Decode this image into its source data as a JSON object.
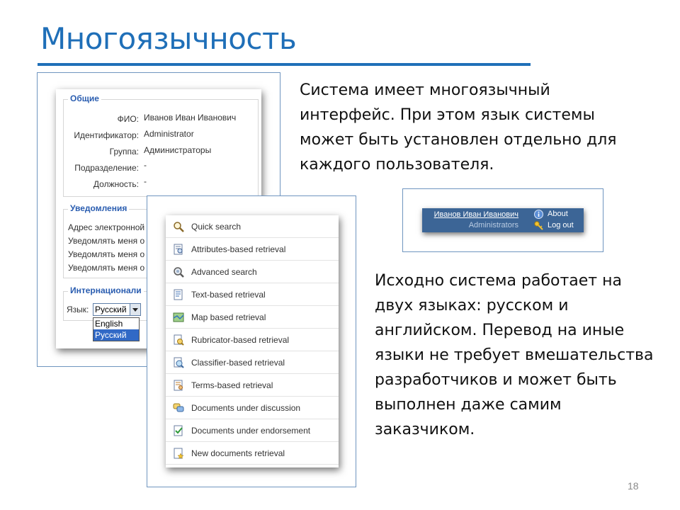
{
  "slide": {
    "title": "Многоязычность",
    "page_number": "18",
    "paragraph1": "Система имеет многоязычный интерфейс. При этом язык системы может быть установлен отдельно для каждого пользователя.",
    "paragraph2": "Исходно система работает на двух языках: русском и английском. Перевод на иные языки не требует вмешательства разработчиков и может быть выполнен даже самим заказчиком."
  },
  "profile_form": {
    "general": {
      "legend": "Общие",
      "fields": [
        {
          "label": "ФИО:",
          "value": "Иванов Иван Иванович"
        },
        {
          "label": "Идентификатор:",
          "value": "Administrator"
        },
        {
          "label": "Группа:",
          "value": "Администраторы"
        },
        {
          "label": "Подразделение:",
          "value": "-"
        },
        {
          "label": "Должность:",
          "value": "-"
        }
      ]
    },
    "notifications": {
      "legend": "Уведомления",
      "lines": [
        "Адрес электронной",
        "Уведомлять меня о",
        "Уведомлять меня о",
        "Уведомлять меня о"
      ]
    },
    "i18n": {
      "legend": "Интернационали",
      "language_label": "Язык:",
      "selected": "Русский",
      "options": [
        "English",
        "Русский"
      ]
    }
  },
  "search_menu": {
    "items": [
      {
        "label": "Quick search",
        "icon": "magnifier-icon"
      },
      {
        "label": "Attributes-based retrieval",
        "icon": "document-search-icon"
      },
      {
        "label": "Advanced search",
        "icon": "advanced-search-icon"
      },
      {
        "label": "Text-based retrieval",
        "icon": "text-document-icon"
      },
      {
        "label": "Map based retrieval",
        "icon": "map-icon"
      },
      {
        "label": "Rubricator-based retrieval",
        "icon": "rubricator-icon"
      },
      {
        "label": "Classifier-based retrieval",
        "icon": "classifier-icon"
      },
      {
        "label": "Terms-based retrieval",
        "icon": "terms-icon"
      },
      {
        "label": "Documents under discussion",
        "icon": "discussion-icon"
      },
      {
        "label": "Documents under endorsement",
        "icon": "endorsement-icon"
      },
      {
        "label": "New documents retrieval",
        "icon": "new-document-icon"
      }
    ]
  },
  "user_bar": {
    "name": "Иванов Иван Иванович",
    "role": "Administrators",
    "about": "About",
    "logout": "Log out"
  },
  "colors": {
    "title": "#1f6fb8",
    "legend": "#2a5db0",
    "user_bar": "#3c6596",
    "selection": "#3169c6"
  }
}
